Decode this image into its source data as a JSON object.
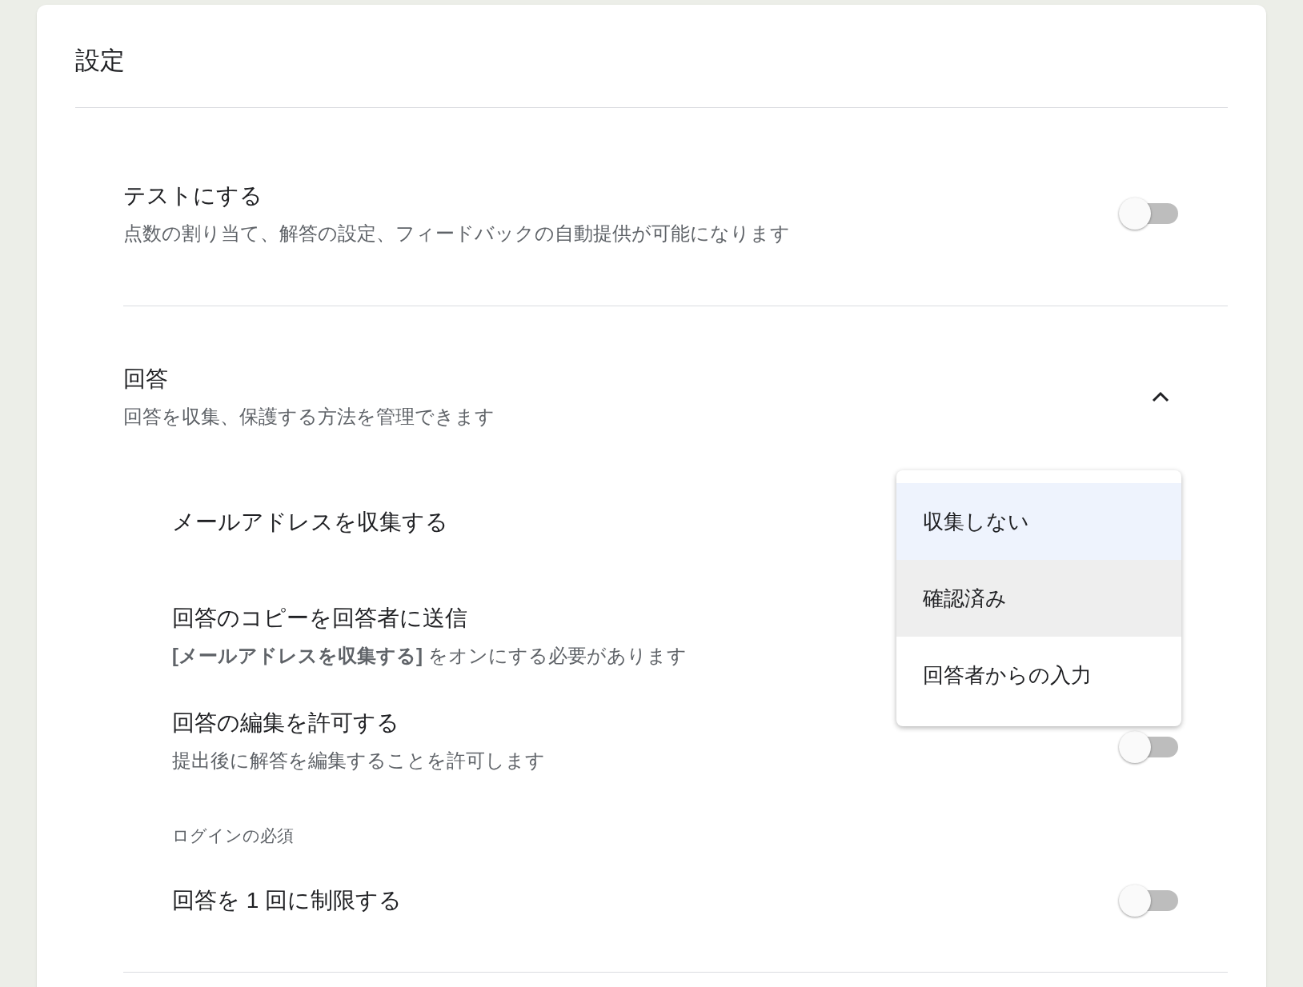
{
  "title": "設定",
  "quiz": {
    "title": "テストにする",
    "description": "点数の割り当て、解答の設定、フィードバックの自動提供が可能になります",
    "toggle": {
      "on": false
    }
  },
  "responses": {
    "title": "回答",
    "description": "回答を収集、保護する方法を管理できます",
    "expanded": true,
    "settings": [
      {
        "kind": "select",
        "title": "メールアドレスを収集する"
      },
      {
        "kind": "select",
        "title": "回答のコピーを回答者に送信",
        "description": "**[メールアドレスを収集する]** をオンにする必要があります"
      },
      {
        "kind": "toggle",
        "title": "回答の編集を許可する",
        "description": "提出後に解答を編集することを許可します",
        "on": false
      },
      {
        "kind": "heading",
        "title": "ログインの必須"
      },
      {
        "kind": "toggle",
        "title": "回答を 1 回に制限する",
        "on": false
      }
    ]
  },
  "dropdown": {
    "options": [
      {
        "label": "収集しない",
        "selected": true,
        "highlighted": false
      },
      {
        "label": "確認済み",
        "selected": false,
        "highlighted": true
      },
      {
        "label": "回答者からの入力",
        "selected": false,
        "highlighted": false
      }
    ]
  }
}
